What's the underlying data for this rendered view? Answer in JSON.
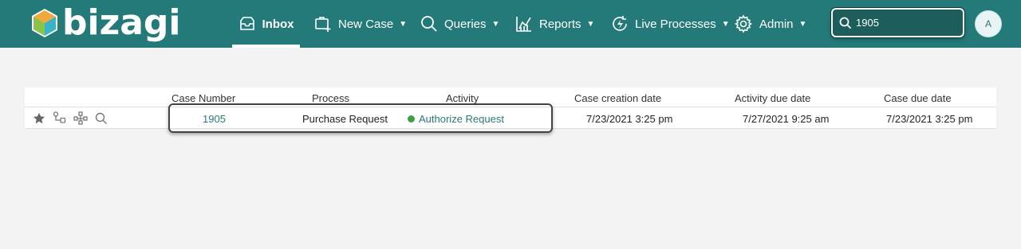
{
  "app": {
    "logo_text": "bizagi"
  },
  "nav": {
    "inbox": "Inbox",
    "new_case": "New Case",
    "queries": "Queries",
    "reports": "Reports",
    "live_processes": "Live Processes",
    "admin": "Admin"
  },
  "search": {
    "value": "1905"
  },
  "user": {
    "initial": "A"
  },
  "table": {
    "headers": {
      "case_number": "Case Number",
      "process": "Process",
      "activity": "Activity",
      "case_creation_date": "Case creation date",
      "activity_due_date": "Activity due date",
      "case_due_date": "Case due date"
    },
    "rows": [
      {
        "case_number": "1905",
        "process": "Purchase Request",
        "activity": "Authorize Request",
        "activity_status_color": "#3da144",
        "case_creation_date": "7/23/2021 3:25 pm",
        "activity_due_date": "7/27/2021 9:25 am",
        "case_due_date": "7/23/2021 3:25 pm"
      }
    ]
  },
  "colors": {
    "header_bg": "#247a78",
    "link": "#2a7a78"
  },
  "icons": [
    "star-icon",
    "workflow-icon",
    "hierarchy-icon",
    "search-icon"
  ]
}
